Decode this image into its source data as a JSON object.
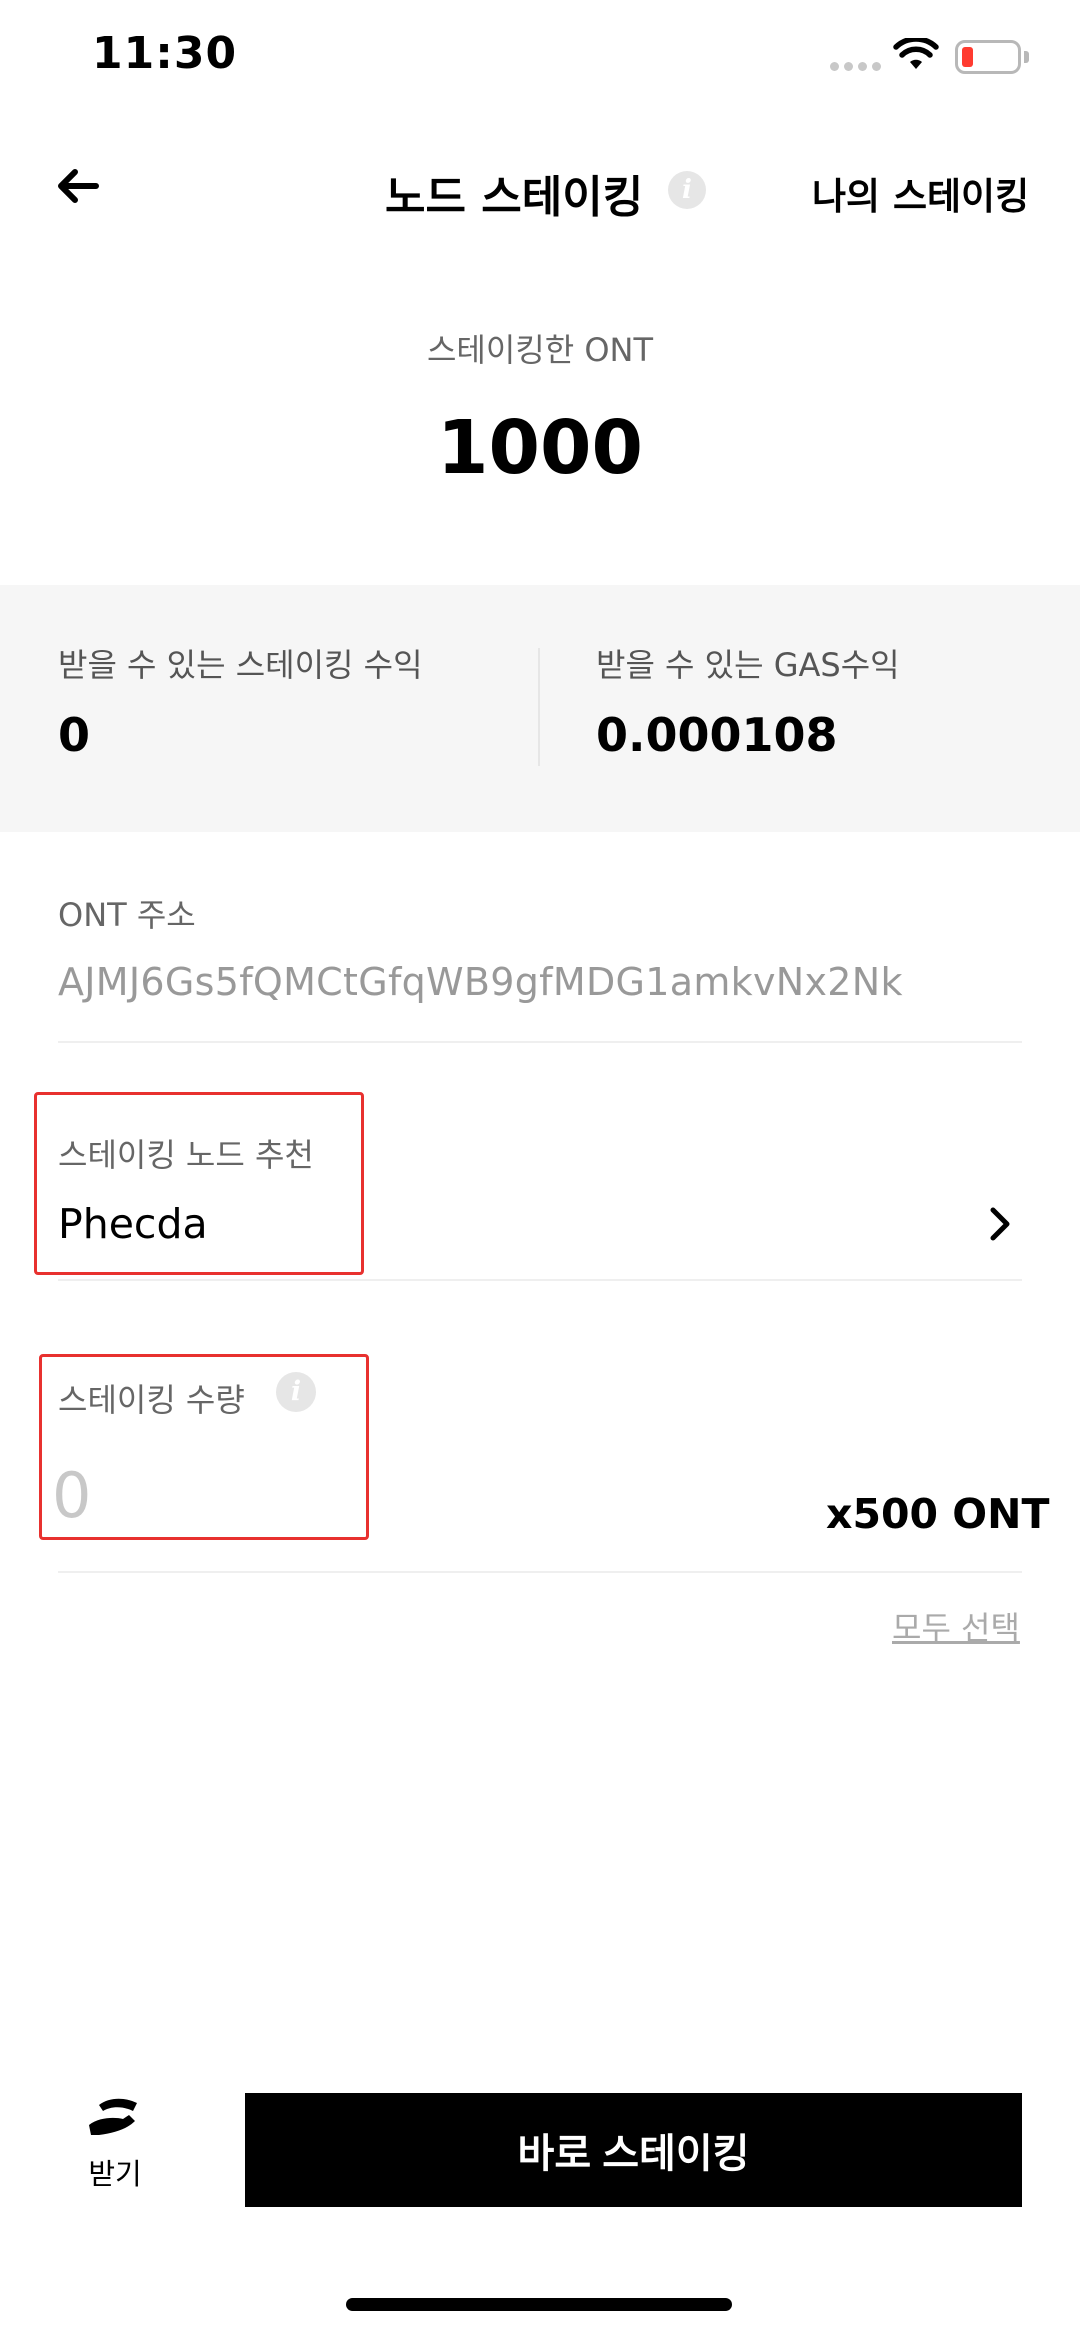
{
  "status_bar": {
    "time": "11:30"
  },
  "nav": {
    "title": "노드 스테이킹",
    "info_icon": "i",
    "my_staking_label": "나의 스테이킹"
  },
  "staked": {
    "label": "스테이킹한 ONT",
    "value": "1000"
  },
  "rewards": {
    "staking_label": "받을 수 있는 스테이킹 수익",
    "staking_value": "0",
    "gas_label": "받을 수 있는 GAS수익",
    "gas_value": "0.000108"
  },
  "address": {
    "label": "ONT 주소",
    "value": "AJMJ6Gs5fQMCtGfqWB9gfMDG1amkvNx2Nk"
  },
  "node": {
    "label": "스테이킹 노드 추천",
    "value": "Phecda"
  },
  "amount": {
    "label": "스테이킹 수량",
    "info_icon": "i",
    "placeholder": "0",
    "unit": "x500 ONT",
    "select_all": "모두 선택"
  },
  "bottom": {
    "receive_label": "받기",
    "stake_button": "바로 스테이킹"
  },
  "colors": {
    "highlight_box": "#e8312f",
    "panel_bg": "#f6f6f6",
    "primary_button": "#000000",
    "battery_low": "#ff3b30"
  }
}
